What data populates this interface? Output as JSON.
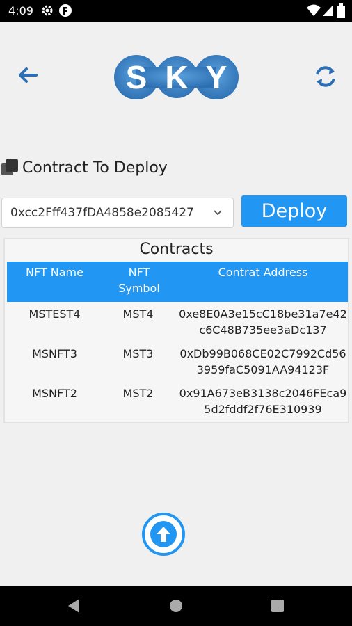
{
  "status": {
    "time": "4:09",
    "icons": [
      "gear-icon",
      "app-f-icon",
      "wifi-icon",
      "signal-icon",
      "battery-icon"
    ]
  },
  "header": {
    "back_icon": "arrow-left-icon",
    "logo_letters": [
      "S",
      "K",
      "Y"
    ],
    "refresh_icon": "refresh-icon"
  },
  "section": {
    "title": "Contract To Deploy",
    "icon": "copy-icon"
  },
  "contract_select": {
    "value": "0xcc2Fff437fDA4858e2085427"
  },
  "deploy_button": {
    "label": "Deploy"
  },
  "contracts": {
    "title": "Contracts",
    "headers": [
      "NFT Name",
      "NFT Symbol",
      "Contrat Address"
    ],
    "rows": [
      {
        "name": "MSTEST4",
        "symbol": "MST4",
        "address": "0xe8E0A3e15cC18be31a7e42c6C48B735ee3aDc137"
      },
      {
        "name": "MSNFT3",
        "symbol": "MST3",
        "address": "0xDb99B068CE02C7992Cd563959faC5091AA94123F"
      },
      {
        "name": "MSNFT2",
        "symbol": "MST2",
        "address": "0x91A673eB3138c2046FEca95d2fddf2f76E310939"
      }
    ]
  },
  "upload_button": {
    "icon": "arrow-up-circle-icon"
  },
  "nav": {
    "icons": [
      "back-triangle-icon",
      "home-circle-icon",
      "recents-square-icon"
    ]
  },
  "colors": {
    "accent": "#2196f3",
    "logo": "#3a7fc0"
  }
}
